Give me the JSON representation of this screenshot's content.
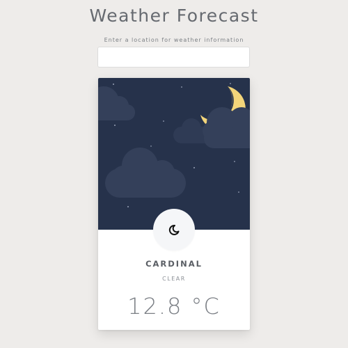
{
  "header": {
    "title": "Weather Forecast",
    "prompt": "Enter a location for weather information"
  },
  "search": {
    "value": "",
    "placeholder": ""
  },
  "weather": {
    "city": "CARDINAL",
    "condition": "CLEAR",
    "temperature": "12.8 °C",
    "scene_icon": "crescent-moon-icon",
    "condition_icon": "clear-night-icon"
  },
  "colors": {
    "background": "#eeecea",
    "sky": "#26324b",
    "cloud": "#34405a",
    "moon": "#f3d57a",
    "text": "#666a70"
  }
}
